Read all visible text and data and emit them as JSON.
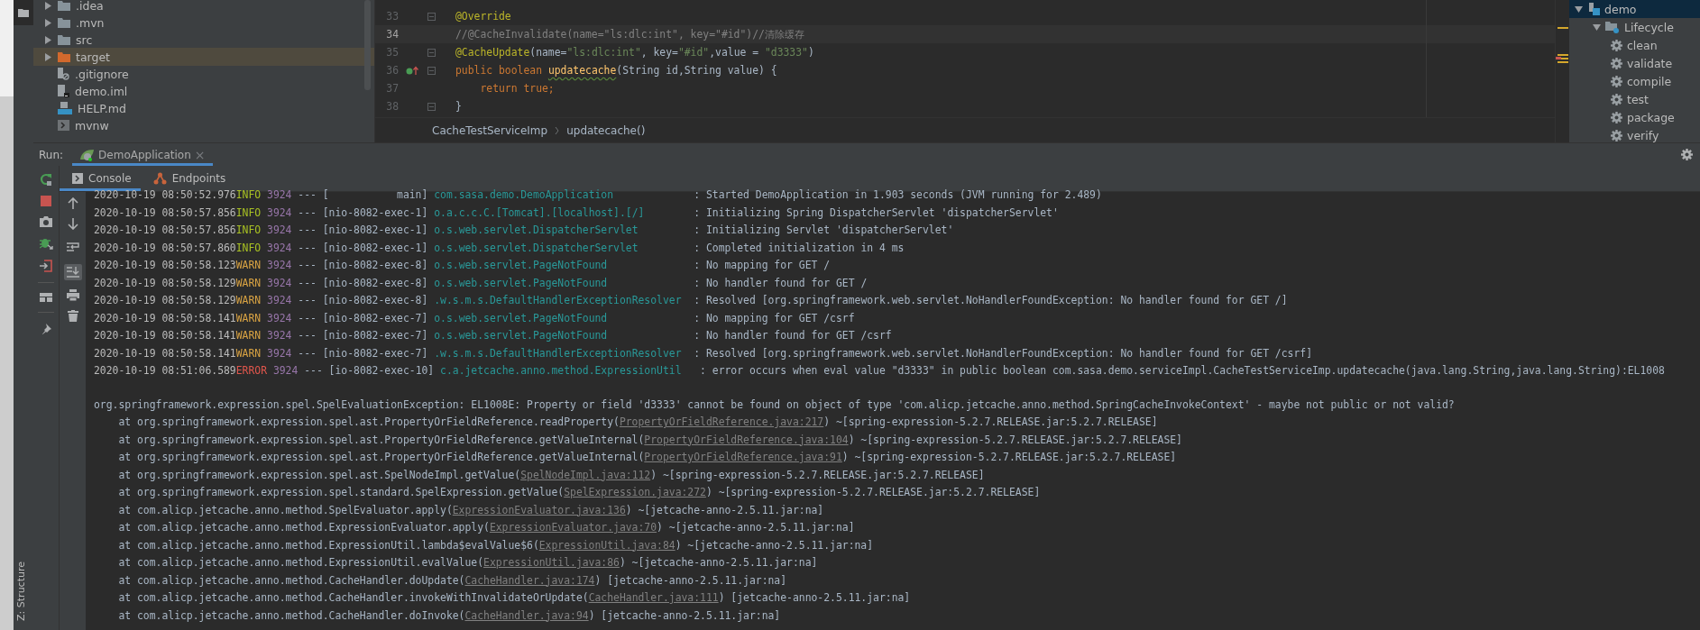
{
  "project_tree": [
    {
      "name": ".idea",
      "kind": "folder",
      "expanded": false,
      "selected": false
    },
    {
      "name": ".mvn",
      "kind": "folder",
      "expanded": false,
      "selected": false
    },
    {
      "name": "src",
      "kind": "folder",
      "expanded": false,
      "selected": false
    },
    {
      "name": "target",
      "kind": "excluded",
      "expanded": false,
      "selected": true
    },
    {
      "name": ".gitignore",
      "kind": "ignore",
      "selected": false
    },
    {
      "name": "demo.iml",
      "kind": "iml",
      "selected": false
    },
    {
      "name": "HELP.md",
      "kind": "md",
      "selected": false
    },
    {
      "name": "mvnw",
      "kind": "script",
      "selected": false
    }
  ],
  "editor": {
    "lines": [
      {
        "number": "33",
        "current": false,
        "fold": true,
        "marker": false,
        "tokens": [
          {
            "t": "@Override",
            "kind": "annotation"
          }
        ]
      },
      {
        "number": "34",
        "current": true,
        "fold": false,
        "marker": false,
        "tokens": [
          {
            "t": "//@CacheInvalidate(name=\"ls:dlc:int\", key=\"#id\")//清除缓存",
            "kind": "comment"
          }
        ]
      },
      {
        "number": "35",
        "current": false,
        "fold": true,
        "marker": false,
        "tokens": [
          {
            "t": "@CacheUpdate",
            "kind": "annotation"
          },
          {
            "t": "(name=",
            "kind": "plain"
          },
          {
            "t": "\"ls:dlc:int\"",
            "kind": "string"
          },
          {
            "t": ", key=",
            "kind": "plain"
          },
          {
            "t": "\"#id\"",
            "kind": "string"
          },
          {
            "t": ",value = ",
            "kind": "plain"
          },
          {
            "t": "\"d3333\"",
            "kind": "string"
          },
          {
            "t": ")",
            "kind": "plain"
          }
        ]
      },
      {
        "number": "36",
        "current": false,
        "fold": true,
        "marker": true,
        "tokens": [
          {
            "t": "public boolean ",
            "kind": "keyword"
          },
          {
            "t": "updatecache",
            "kind": "method"
          },
          {
            "t": "(String id,String value) {",
            "kind": "plain"
          }
        ]
      },
      {
        "number": "37",
        "current": false,
        "fold": false,
        "marker": false,
        "tokens": [
          {
            "t": "    return true;",
            "kind": "keyword"
          }
        ]
      },
      {
        "number": "38",
        "current": false,
        "fold": true,
        "marker": false,
        "tokens": [
          {
            "t": "}",
            "kind": "plain"
          }
        ]
      }
    ],
    "breadcrumbs": [
      "CacheTestServiceImp",
      "updatecache()"
    ]
  },
  "maven": [
    {
      "label": "demo",
      "kind": "project",
      "expanded": true,
      "selected": true,
      "children": [
        {
          "label": "Lifecycle",
          "kind": "group",
          "expanded": true,
          "selected": false,
          "children": [
            {
              "label": "clean",
              "kind": "goal",
              "selected": false
            },
            {
              "label": "validate",
              "kind": "goal",
              "selected": false
            },
            {
              "label": "compile",
              "kind": "goal",
              "selected": false
            },
            {
              "label": "test",
              "kind": "goal",
              "selected": false
            },
            {
              "label": "package",
              "kind": "goal",
              "selected": false
            },
            {
              "label": "verify",
              "kind": "goal",
              "selected": false
            }
          ]
        }
      ]
    }
  ],
  "run": {
    "label": "Run:",
    "tabs": [
      {
        "label": "DemoApplication",
        "selected": true,
        "close": "×"
      }
    ]
  },
  "console_tabs": [
    {
      "label": "Console",
      "kind": "console",
      "selected": true
    },
    {
      "label": "Endpoints",
      "kind": "endpoints",
      "selected": false
    }
  ],
  "console_tools": {
    "soft_wrap": false,
    "scroll_to_end": true
  },
  "console": [
    {
      "kind": "log",
      "time": "2020-10-19 08:50:52.976",
      "level": "INFO",
      "color": "#a8c023",
      "pid": "3924",
      "sep": "---",
      "thread": "[           main]",
      "logger": "com.sasa.demo.DemoApplication",
      "message": ": Started DemoApplication in 1.903 seconds (JVM running for 2.489)"
    },
    {
      "kind": "log",
      "time": "2020-10-19 08:50:57.856",
      "level": "INFO",
      "color": "#a8c023",
      "pid": "3924",
      "sep": "---",
      "thread": "[nio-8082-exec-1]",
      "logger": "o.a.c.c.C.[Tomcat].[localhost].[/]",
      "message": ": Initializing Spring DispatcherServlet 'dispatcherServlet'"
    },
    {
      "kind": "log",
      "time": "2020-10-19 08:50:57.856",
      "level": "INFO",
      "color": "#a8c023",
      "pid": "3924",
      "sep": "---",
      "thread": "[nio-8082-exec-1]",
      "logger": "o.s.web.servlet.DispatcherServlet",
      "message": ": Initializing Servlet 'dispatcherServlet'"
    },
    {
      "kind": "log",
      "time": "2020-10-19 08:50:57.860",
      "level": "INFO",
      "color": "#a8c023",
      "pid": "3924",
      "sep": "---",
      "thread": "[nio-8082-exec-1]",
      "logger": "o.s.web.servlet.DispatcherServlet",
      "message": ": Completed initialization in 4 ms"
    },
    {
      "kind": "log",
      "time": "2020-10-19 08:50:58.123",
      "level": "WARN",
      "color": "#d9a343",
      "pid": "3924",
      "sep": "---",
      "thread": "[nio-8082-exec-8]",
      "logger": "o.s.web.servlet.PageNotFound",
      "message": ": No mapping for GET /"
    },
    {
      "kind": "log",
      "time": "2020-10-19 08:50:58.129",
      "level": "WARN",
      "color": "#d9a343",
      "pid": "3924",
      "sep": "---",
      "thread": "[nio-8082-exec-8]",
      "logger": "o.s.web.servlet.PageNotFound",
      "message": ": No handler found for GET /"
    },
    {
      "kind": "log",
      "time": "2020-10-19 08:50:58.129",
      "level": "WARN",
      "color": "#d9a343",
      "pid": "3924",
      "sep": "---",
      "thread": "[nio-8082-exec-8]",
      "logger": ".w.s.m.s.DefaultHandlerExceptionResolver",
      "message": ": Resolved [org.springframework.web.servlet.NoHandlerFoundException: No handler found for GET /]"
    },
    {
      "kind": "log",
      "time": "2020-10-19 08:50:58.141",
      "level": "WARN",
      "color": "#d9a343",
      "pid": "3924",
      "sep": "---",
      "thread": "[nio-8082-exec-7]",
      "logger": "o.s.web.servlet.PageNotFound",
      "message": ": No mapping for GET /csrf"
    },
    {
      "kind": "log",
      "time": "2020-10-19 08:50:58.141",
      "level": "WARN",
      "color": "#d9a343",
      "pid": "3924",
      "sep": "---",
      "thread": "[nio-8082-exec-7]",
      "logger": "o.s.web.servlet.PageNotFound",
      "message": ": No handler found for GET /csrf"
    },
    {
      "kind": "log",
      "time": "2020-10-19 08:50:58.141",
      "level": "WARN",
      "color": "#d9a343",
      "pid": "3924",
      "sep": "---",
      "thread": "[nio-8082-exec-7]",
      "logger": ".w.s.m.s.DefaultHandlerExceptionResolver",
      "message": ": Resolved [org.springframework.web.servlet.NoHandlerFoundException: No handler found for GET /csrf]"
    },
    {
      "kind": "log",
      "time": "2020-10-19 08:51:06.589",
      "level": "ERROR",
      "color": "#e0564c",
      "pid": "3924",
      "sep": "---",
      "thread": "[io-8082-exec-10]",
      "logger": "c.a.jetcache.anno.method.ExpressionUtil",
      "message": ": error occurs when eval value \"d3333\" in public boolean com.sasa.demo.serviceImpl.CacheTestServiceImp.updatecache(java.lang.String,java.lang.String):EL1008"
    },
    {
      "kind": "exception",
      "text": "org.springframework.expression.spel.SpelEvaluationException: EL1008E: Property or field 'd3333' cannot be found on object of type 'com.alicp.jetcache.anno.method.SpringCacheInvokeContext' - maybe not public or not valid?"
    },
    {
      "kind": "trace",
      "call": "at org.springframework.expression.spel.ast.PropertyOrFieldReference.readProperty(",
      "source": "PropertyOrFieldReference.java:217",
      "jar": ") ~[spring-expression-5.2.7.RELEASE.jar:5.2.7.RELEASE]"
    },
    {
      "kind": "trace",
      "call": "at org.springframework.expression.spel.ast.PropertyOrFieldReference.getValueInternal(",
      "source": "PropertyOrFieldReference.java:104",
      "jar": ") ~[spring-expression-5.2.7.RELEASE.jar:5.2.7.RELEASE]"
    },
    {
      "kind": "trace",
      "call": "at org.springframework.expression.spel.ast.PropertyOrFieldReference.getValueInternal(",
      "source": "PropertyOrFieldReference.java:91",
      "jar": ") ~[spring-expression-5.2.7.RELEASE.jar:5.2.7.RELEASE]"
    },
    {
      "kind": "trace",
      "call": "at org.springframework.expression.spel.ast.SpelNodeImpl.getValue(",
      "source": "SpelNodeImpl.java:112",
      "jar": ") ~[spring-expression-5.2.7.RELEASE.jar:5.2.7.RELEASE]"
    },
    {
      "kind": "trace",
      "call": "at org.springframework.expression.spel.standard.SpelExpression.getValue(",
      "source": "SpelExpression.java:272",
      "jar": ") ~[spring-expression-5.2.7.RELEASE.jar:5.2.7.RELEASE]"
    },
    {
      "kind": "trace",
      "call": "at com.alicp.jetcache.anno.method.SpelEvaluator.apply(",
      "source": "ExpressionEvaluator.java:136",
      "jar": ") ~[jetcache-anno-2.5.11.jar:na]"
    },
    {
      "kind": "trace",
      "call": "at com.alicp.jetcache.anno.method.ExpressionEvaluator.apply(",
      "source": "ExpressionEvaluator.java:70",
      "jar": ") ~[jetcache-anno-2.5.11.jar:na]"
    },
    {
      "kind": "trace",
      "call": "at com.alicp.jetcache.anno.method.ExpressionUtil.lambda$evalValue$6(",
      "source": "ExpressionUtil.java:84",
      "jar": ") ~[jetcache-anno-2.5.11.jar:na]"
    },
    {
      "kind": "trace",
      "call": "at com.alicp.jetcache.anno.method.ExpressionUtil.evalValue(",
      "source": "ExpressionUtil.java:86",
      "jar": ") ~[jetcache-anno-2.5.11.jar:na]"
    },
    {
      "kind": "trace",
      "call": "at com.alicp.jetcache.anno.method.CacheHandler.doUpdate(",
      "source": "CacheHandler.java:174",
      "jar": ") [jetcache-anno-2.5.11.jar:na]"
    },
    {
      "kind": "trace",
      "call": "at com.alicp.jetcache.anno.method.CacheHandler.invokeWithInvalidateOrUpdate(",
      "source": "CacheHandler.java:111",
      "jar": ") [jetcache-anno-2.5.11.jar:na]"
    },
    {
      "kind": "trace",
      "call": "at com.alicp.jetcache.anno.method.CacheHandler.doInvoke(",
      "source": "CacheHandler.java:94",
      "jar": ") [jetcache-anno-2.5.11.jar:na]"
    }
  ],
  "structure_tab": "Z: Structure"
}
